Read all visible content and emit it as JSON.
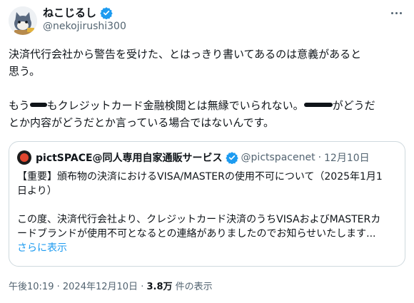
{
  "author": {
    "display_name": "ねこじるし",
    "handle": "@nekojirushi300",
    "verified": true
  },
  "tweet": {
    "line1": "決済代行会社から警告を受けた、とはっきり書いてあるのは意義があると",
    "line2": "思う。",
    "line3a": "もう",
    "line3b": "もクレジットカード金融検閲とは無縁でいられない。",
    "line3c": "がどうだ",
    "line4": "とか内容がどうだとか言っている場合ではないんです。"
  },
  "quote": {
    "name": "pictSPACE@同人専用自家通販サービス",
    "verified": true,
    "handle": "@pictspacenet",
    "separator": "·",
    "date": "12月10日",
    "body_line1": "【重要】頒布物の決済におけるVISA/MASTERの使用不可について（2025年1月1",
    "body_line2": "日より）",
    "body_line3": "この度、決済代行会社より、クレジットカード決済のうちVISAおよびMASTERカ",
    "body_line4": "ードブランドが使用不可となるとの連絡がありましたのでお知らせいたします...",
    "show_more": "さらに表示"
  },
  "meta": {
    "time": "午後10:19",
    "separator": "·",
    "date": "2024年12月10日",
    "views_count": "3.8万",
    "views_label": "件の表示"
  },
  "colors": {
    "verified": "#1d9bf0",
    "link": "#1d9bf0",
    "secondary_text": "#536471",
    "border": "#cfd9de"
  }
}
